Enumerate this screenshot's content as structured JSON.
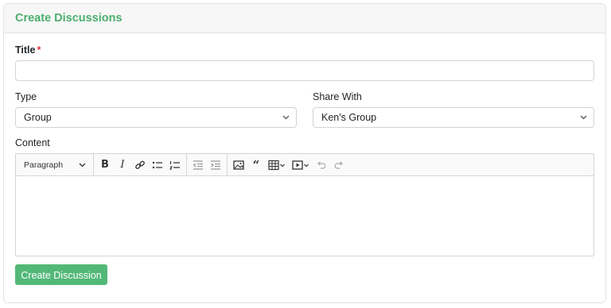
{
  "header": {
    "title": "Create Discussions"
  },
  "form": {
    "title_label": "Title",
    "title_required_mark": "*",
    "title_value": "",
    "type_label": "Type",
    "type_value": "Group",
    "share_label": "Share With",
    "share_value": "Ken's Group",
    "content_label": "Content"
  },
  "editor": {
    "paragraph_format": "Paragraph",
    "tools": [
      "bold-icon",
      "italic-icon",
      "link-icon",
      "bulleted-list-icon",
      "numbered-list-icon",
      "outdent-icon",
      "indent-icon",
      "image-icon",
      "blockquote-icon",
      "table-icon",
      "media-icon",
      "undo-icon",
      "redo-icon"
    ]
  },
  "submit": {
    "label": "Create Discussion"
  },
  "colors": {
    "accent": "#4caf6e",
    "button": "#52b878",
    "required": "#dc3545"
  }
}
